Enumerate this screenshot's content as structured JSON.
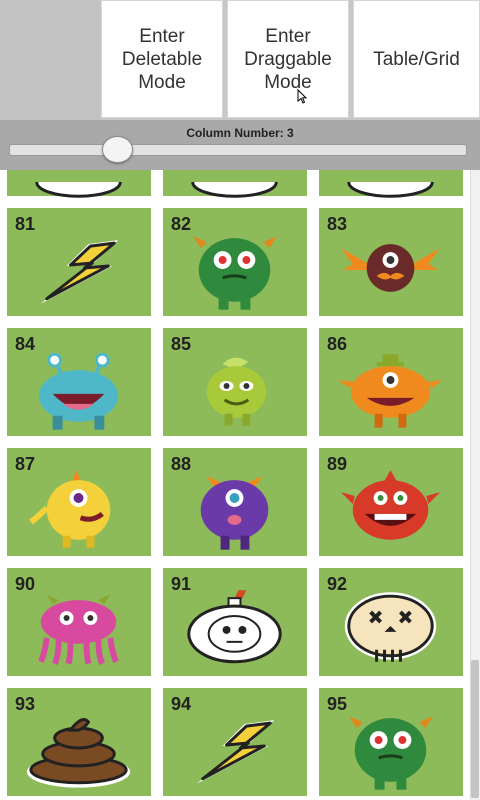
{
  "toolbar": {
    "deletable_label": "Enter\nDeletable\nMode",
    "draggable_label": "Enter\nDraggable\nMode",
    "table_grid_label": "Table/Grid"
  },
  "slider": {
    "label": "Column Number: 3",
    "value_fraction": 0.22
  },
  "grid": {
    "columns": 3,
    "tile_color": "#8dbb59",
    "partial_row_icons": [
      "partial-icon",
      "partial-icon",
      "partial-icon"
    ],
    "items": [
      {
        "number": "81",
        "icon": "lightning-bolt-icon"
      },
      {
        "number": "82",
        "icon": "green-furry-monster-icon"
      },
      {
        "number": "83",
        "icon": "bat-wing-mustache-monster-icon"
      },
      {
        "number": "84",
        "icon": "blue-tentacle-monster-icon"
      },
      {
        "number": "85",
        "icon": "lime-monster-icon"
      },
      {
        "number": "86",
        "icon": "orange-hat-monster-icon"
      },
      {
        "number": "87",
        "icon": "yellow-furry-monster-icon"
      },
      {
        "number": "88",
        "icon": "purple-monster-icon"
      },
      {
        "number": "89",
        "icon": "red-monster-icon"
      },
      {
        "number": "90",
        "icon": "pink-octopus-monster-icon"
      },
      {
        "number": "91",
        "icon": "skull-bomb-icon"
      },
      {
        "number": "92",
        "icon": "skull-icon"
      },
      {
        "number": "93",
        "icon": "poop-icon"
      },
      {
        "number": "94",
        "icon": "lightning-bolt-icon"
      },
      {
        "number": "95",
        "icon": "green-furry-monster-icon"
      }
    ]
  }
}
